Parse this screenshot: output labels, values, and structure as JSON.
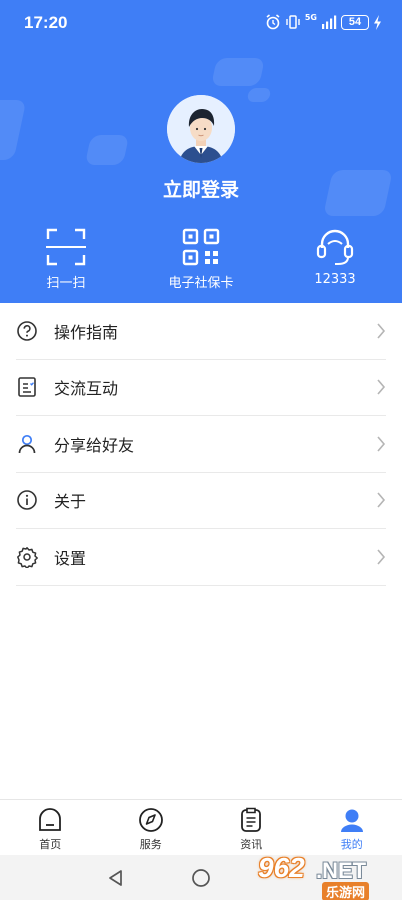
{
  "status_bar": {
    "time": "17:20",
    "network": "5G",
    "battery": "54"
  },
  "profile": {
    "login_label": "立即登录"
  },
  "quick_actions": [
    {
      "label": "扫一扫",
      "icon": "scan-icon"
    },
    {
      "label": "电子社保卡",
      "icon": "qr-code-icon"
    },
    {
      "label": "12333",
      "icon": "headset-icon"
    }
  ],
  "menu": [
    {
      "label": "操作指南",
      "icon": "question-circle-icon"
    },
    {
      "label": "交流互动",
      "icon": "document-list-icon"
    },
    {
      "label": "分享给好友",
      "icon": "person-icon"
    },
    {
      "label": "关于",
      "icon": "info-circle-icon"
    },
    {
      "label": "设置",
      "icon": "gear-icon"
    }
  ],
  "tabbar": [
    {
      "label": "首页",
      "icon": "home-icon"
    },
    {
      "label": "服务",
      "icon": "compass-icon"
    },
    {
      "label": "资讯",
      "icon": "clipboard-icon"
    },
    {
      "label": "我的",
      "icon": "user-icon",
      "active": true
    }
  ],
  "watermark": {
    "number": "962",
    "net": ".NET",
    "text": "乐游网"
  },
  "colors": {
    "primary": "#3f7ef6",
    "divider": "#e9e9e9",
    "text": "#222222"
  }
}
